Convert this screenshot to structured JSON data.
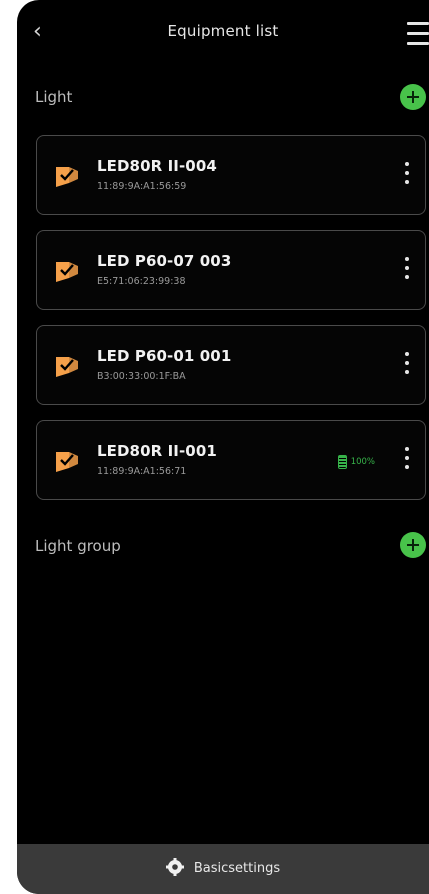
{
  "header": {
    "back_icon": "chevron-left-icon",
    "title": "Equipment list",
    "menu_icon": "hamburger-menu-icon"
  },
  "sections": {
    "light": {
      "label": "Light",
      "add_icon": "plus-circle-icon"
    },
    "light_group": {
      "label": "Light group",
      "add_icon": "plus-circle-icon"
    }
  },
  "devices": [
    {
      "name": "LED80R II-004",
      "mac": "11:89:9A:A1:56:59",
      "battery": null
    },
    {
      "name": "LED P60-07 003",
      "mac": "E5:71:06:23:99:38",
      "battery": null
    },
    {
      "name": "LED P60-01 001",
      "mac": "B3:00:33:00:1F:BA",
      "battery": null
    },
    {
      "name": "LED80R II-001",
      "mac": "11:89:9A:A1:56:71",
      "battery": "100%"
    }
  ],
  "footer": {
    "gear_icon": "gear-icon",
    "label": "Basicsettings"
  },
  "colors": {
    "background": "#000000",
    "accent_green": "#48c24a",
    "lamp_orange": "#f5a04a",
    "card_border": "#4a4a4a",
    "bottom_bar": "#3a3a3a"
  }
}
